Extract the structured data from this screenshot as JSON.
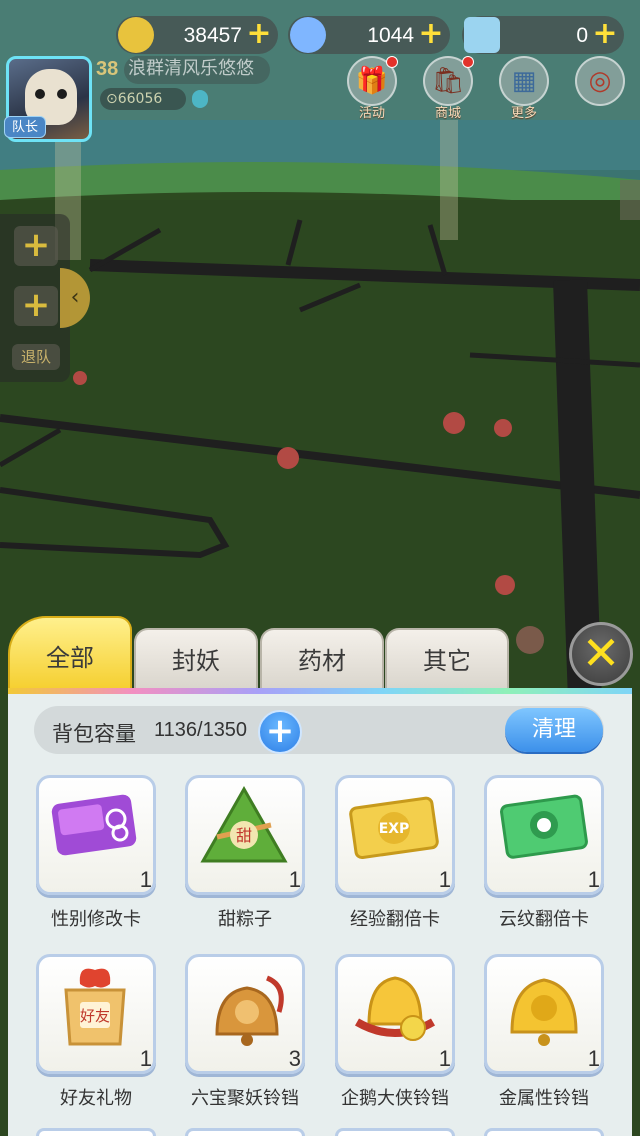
{
  "currencies": [
    {
      "name": "gold",
      "icon": "gold-crystal-icon",
      "value": "38457",
      "color": "#e8c33d"
    },
    {
      "name": "diamond",
      "icon": "diamond-icon",
      "value": "1044",
      "color": "#7fb6ff"
    },
    {
      "name": "ticket",
      "icon": "ticket-icon",
      "value": "0",
      "color": "#9bd4f0"
    }
  ],
  "player": {
    "level": "38",
    "name": "浪群清风乐悠悠",
    "power": "66056",
    "badge": "队长"
  },
  "top_menu": [
    {
      "label": "活动",
      "icon": "gift-icon",
      "symbol": "🎁"
    },
    {
      "label": "商城",
      "icon": "shop-icon",
      "symbol": "🛍"
    },
    {
      "label": "更多",
      "icon": "grid-icon",
      "symbol": "▦"
    },
    {
      "label": "",
      "icon": "target-icon",
      "symbol": "◎"
    }
  ],
  "side": {
    "add_symbol": "+",
    "leave_label": "退队",
    "collapse_symbol": "‹"
  },
  "bag": {
    "tabs": [
      "全部",
      "封妖",
      "药材",
      "其它"
    ],
    "active_tab": "全部",
    "close_symbol": "✕",
    "capacity_label": "背包容量",
    "capacity_value": "1136/1350",
    "add_symbol": "+",
    "clean_label": "清理",
    "items": [
      {
        "name": "性别修改卡",
        "qty": "1",
        "icon": "gender-card-icon"
      },
      {
        "name": "甜粽子",
        "qty": "1",
        "icon": "zongzi-icon",
        "text": "甜"
      },
      {
        "name": "经验翻倍卡",
        "qty": "1",
        "icon": "exp-card-icon",
        "text": "EXP"
      },
      {
        "name": "云纹翻倍卡",
        "qty": "1",
        "icon": "cloud-card-icon"
      },
      {
        "name": "好友礼物",
        "qty": "1",
        "icon": "friend-gift-icon",
        "text": "好友"
      },
      {
        "name": "六宝聚妖铃铛",
        "qty": "3",
        "icon": "bronze-bell-icon"
      },
      {
        "name": "企鹅大侠铃铛",
        "qty": "1",
        "icon": "gold-bell-icon"
      },
      {
        "name": "金属性铃铛",
        "qty": "1",
        "icon": "metal-bell-icon"
      }
    ]
  }
}
